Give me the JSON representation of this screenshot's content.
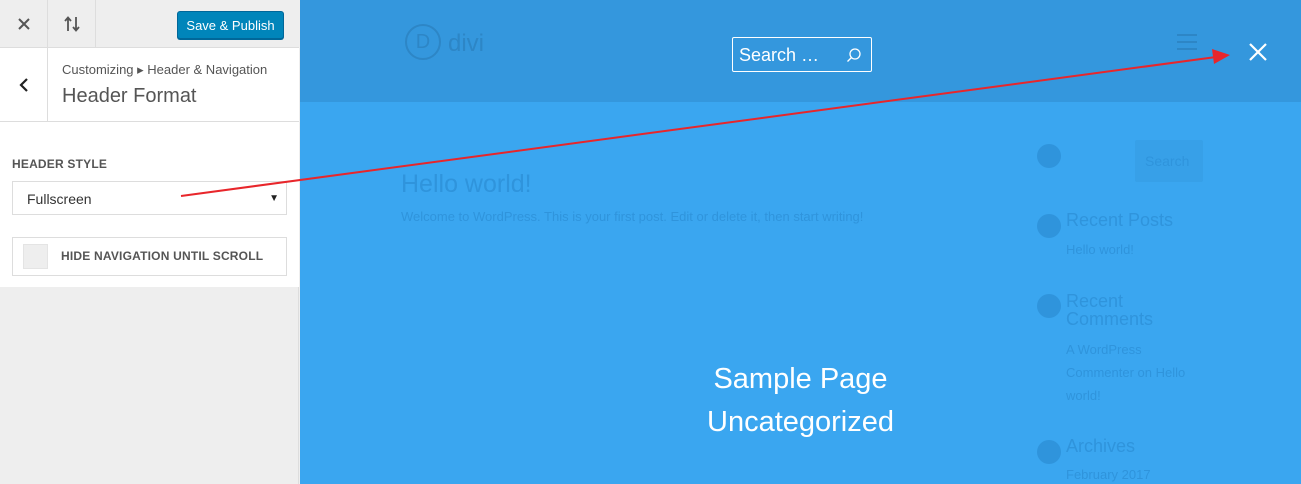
{
  "toolbar": {
    "close_icon": "close-icon",
    "sort_icon": "arrows-updown-icon",
    "publish_label": "Save & Publish",
    "publish_color": "#0085ba"
  },
  "section": {
    "back_icon": "chevron-left-icon",
    "breadcrumb": "Customizing ▸ Header & Navigation",
    "title": "Header Format"
  },
  "controls": {
    "header_style_label": "HEADER STYLE",
    "header_style_value": "Fullscreen",
    "hide_nav_label": "HIDE NAVIGATION UNTIL SCROLL",
    "hide_nav_checked": false
  },
  "preview": {
    "background_color": "#3aa6f0",
    "header_color": "#3497dd",
    "logo_letter": "D",
    "logo_text": "divi",
    "search_placeholder": "Search …",
    "overlay_menu": [
      "Sample Page",
      "Uncategorized"
    ],
    "post": {
      "title": "Hello world!",
      "excerpt": "Welcome to WordPress. This is your first post. Edit or delete it, then start writing!"
    },
    "sidebar": {
      "search_button": "Search",
      "recent_posts_title": "Recent Posts",
      "recent_posts": [
        "Hello world!"
      ],
      "recent_comments_title": "Recent Comments",
      "recent_comments_text": "A WordPress Commenter on Hello world!",
      "archives_title": "Archives",
      "archives": [
        "February 2017"
      ]
    }
  },
  "annotation": {
    "arrow_color": "#e8262b"
  }
}
